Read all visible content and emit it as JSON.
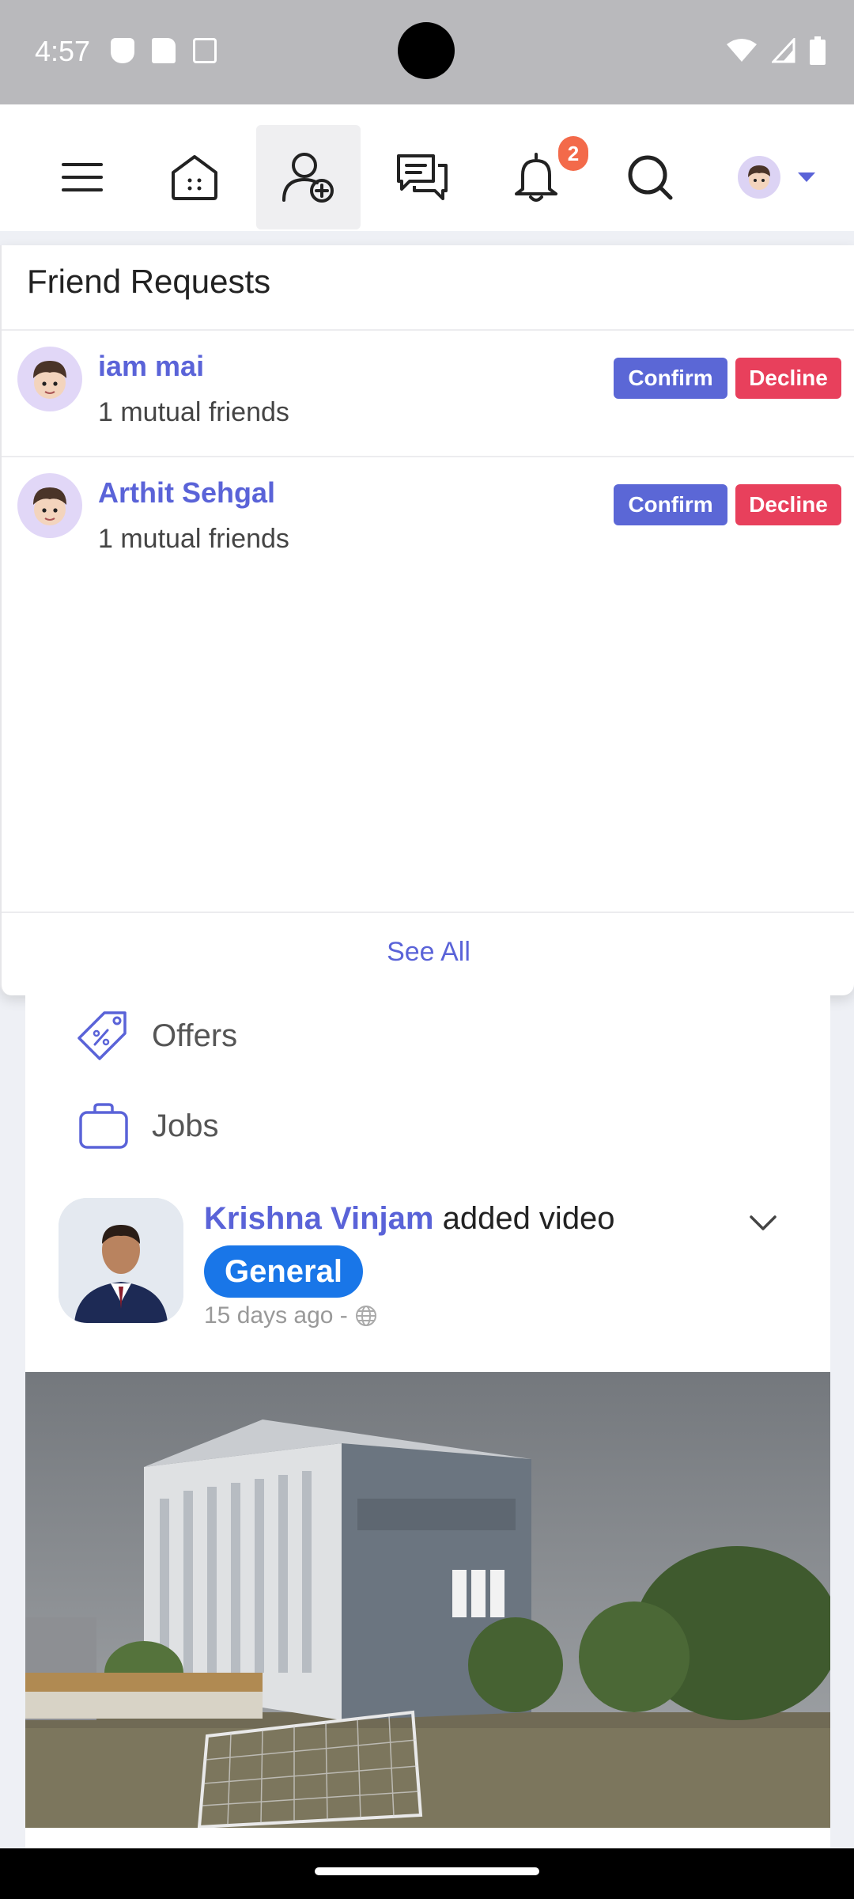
{
  "status_bar": {
    "time": "4:57",
    "icons_left": [
      "shield-icon",
      "sd-card-icon",
      "a-icon"
    ],
    "icons_right": [
      "wifi-icon",
      "signal-icon",
      "battery-icon"
    ]
  },
  "top_nav": {
    "items": [
      {
        "name": "menu",
        "icon": "hamburger-icon"
      },
      {
        "name": "home",
        "icon": "home-icon"
      },
      {
        "name": "friends",
        "icon": "add-friend-icon",
        "active": true
      },
      {
        "name": "messages",
        "icon": "chat-icon"
      },
      {
        "name": "notifications",
        "icon": "bell-icon"
      },
      {
        "name": "search",
        "icon": "search-icon"
      }
    ],
    "notification_count": "2",
    "profile_caret": "caret-down-icon"
  },
  "friend_requests": {
    "title": "Friend Requests",
    "requests": [
      {
        "name": "iam mai",
        "mutual": "1 mutual friends",
        "confirm_label": "Confirm",
        "decline_label": "Decline"
      },
      {
        "name": "Arthit Sehgal",
        "mutual": "1 mutual friends",
        "confirm_label": "Confirm",
        "decline_label": "Decline"
      }
    ],
    "see_all_label": "See All"
  },
  "menu": {
    "items": [
      {
        "label": "Offers",
        "icon": "offer-tag-icon"
      },
      {
        "label": "Jobs",
        "icon": "briefcase-icon"
      }
    ]
  },
  "post": {
    "author": "Krishna Vinjam",
    "action": " added video",
    "tag": "General",
    "time": "15 days ago -",
    "privacy_icon": "globe-icon",
    "options_icon": "chevron-down-icon"
  },
  "colors": {
    "accent": "#5a63d8",
    "confirm": "#5b67d6",
    "decline": "#e8405c",
    "badge": "#f36a4a",
    "tag": "#1976e8"
  }
}
